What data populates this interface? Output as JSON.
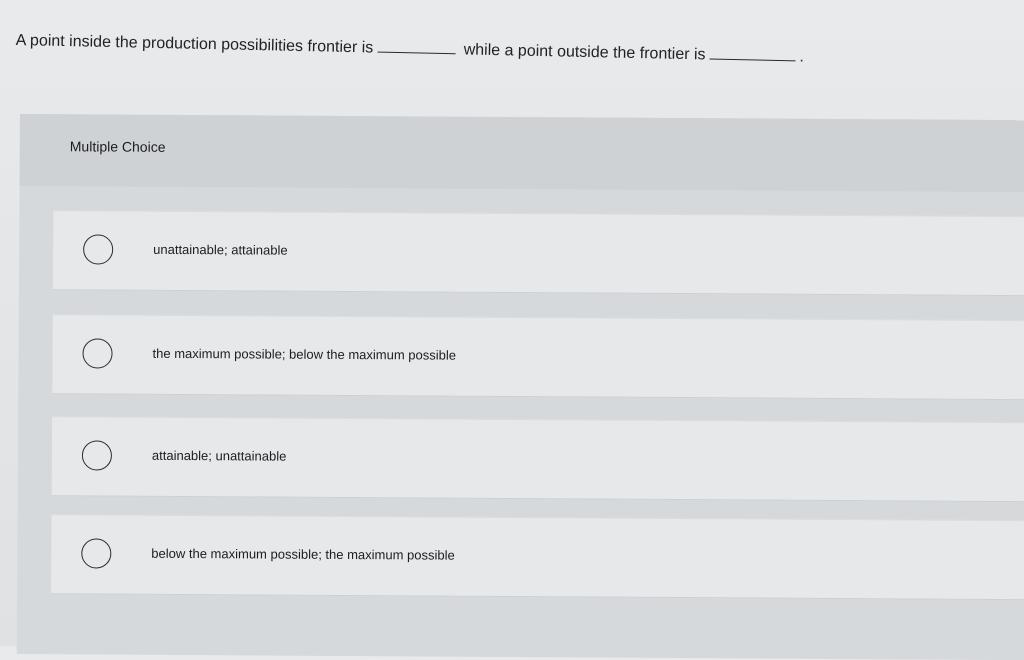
{
  "question": {
    "text_part1": "A point inside the production possibilities frontier is",
    "text_part2": "while a point outside the frontier is",
    "text_end": "."
  },
  "multiple_choice": {
    "label": "Multiple Choice",
    "options": [
      {
        "label": "unattainable; attainable"
      },
      {
        "label": "the maximum possible; below the maximum possible"
      },
      {
        "label": "attainable; unattainable"
      },
      {
        "label": "below the maximum possible; the maximum possible"
      }
    ]
  }
}
